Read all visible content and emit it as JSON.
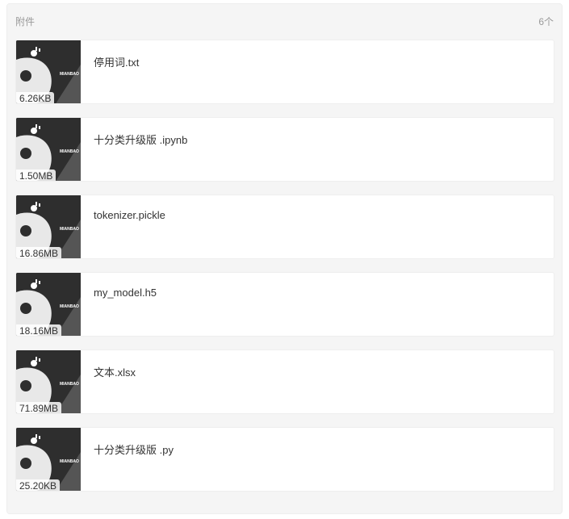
{
  "attachments": {
    "title": "附件",
    "count": "6个",
    "thumbnail_icon": "donut-logo-icon",
    "thumbnail_brand_text": "MIANBAO",
    "items": [
      {
        "name": "停用词.txt",
        "size": "6.26KB"
      },
      {
        "name": "十分类升级版 .ipynb",
        "size": "1.50MB"
      },
      {
        "name": "tokenizer.pickle",
        "size": "16.86MB"
      },
      {
        "name": "my_model.h5",
        "size": "18.16MB"
      },
      {
        "name": "文本.xlsx",
        "size": "71.89MB"
      },
      {
        "name": "十分类升级版 .py",
        "size": "25.20KB"
      }
    ]
  },
  "colors": {
    "panel_bg": "#f5f5f5",
    "thumb_bg": "#2e2e2e",
    "text": "#333333",
    "muted": "#999999"
  }
}
